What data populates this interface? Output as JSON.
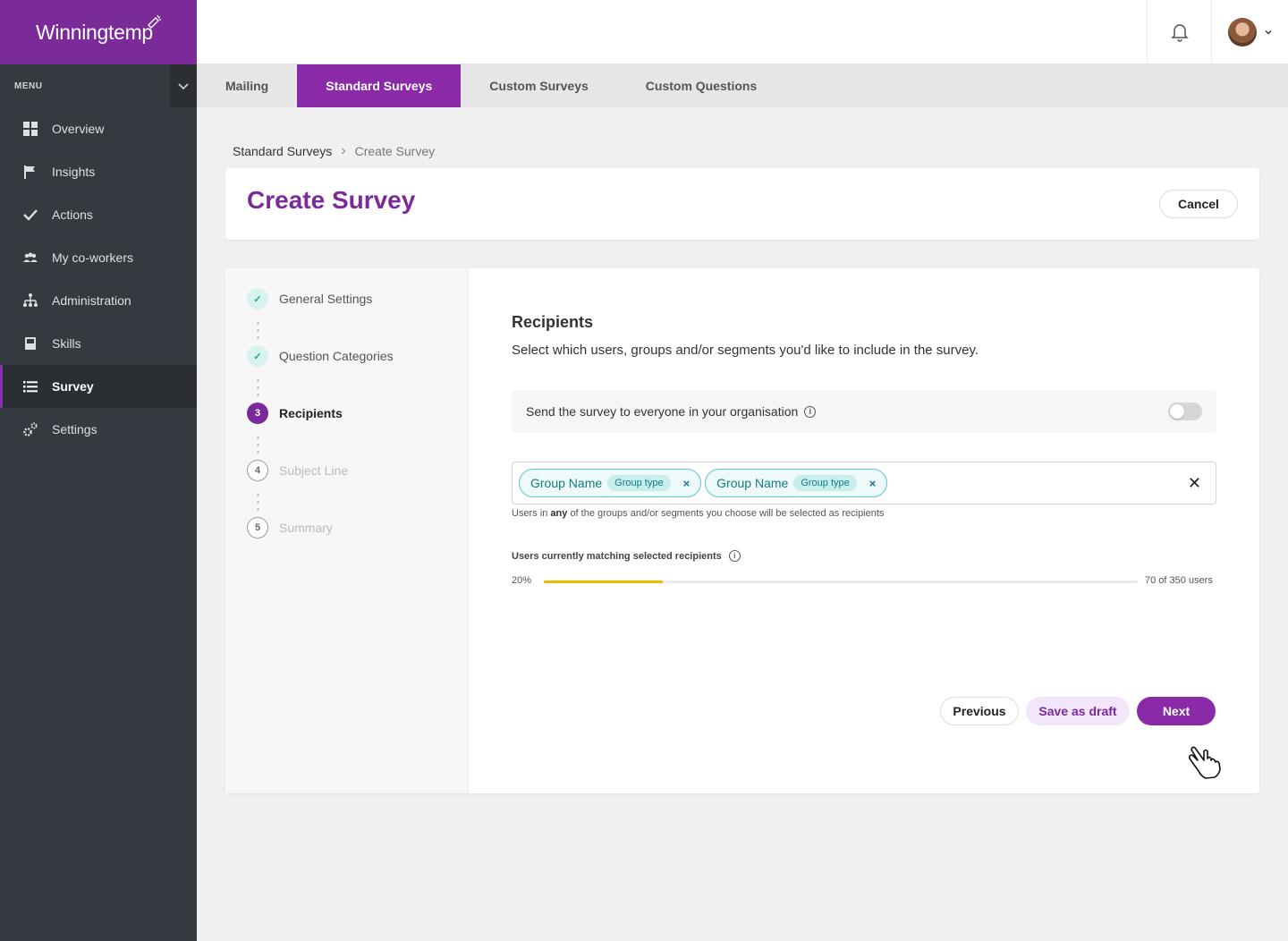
{
  "brand": {
    "name": "Winningtemp"
  },
  "menu": {
    "label": "MENU",
    "items": [
      {
        "label": "Overview",
        "icon": "grid-icon"
      },
      {
        "label": "Insights",
        "icon": "flag-icon"
      },
      {
        "label": "Actions",
        "icon": "check-icon"
      },
      {
        "label": "My co-workers",
        "icon": "people-icon"
      },
      {
        "label": "Administration",
        "icon": "org-chart-icon"
      },
      {
        "label": "Skills",
        "icon": "book-icon"
      },
      {
        "label": "Survey",
        "icon": "list-icon",
        "active": true
      },
      {
        "label": "Settings",
        "icon": "gears-icon"
      }
    ]
  },
  "tabs": [
    {
      "label": "Mailing"
    },
    {
      "label": "Standard Surveys",
      "active": true
    },
    {
      "label": "Custom Surveys"
    },
    {
      "label": "Custom Questions"
    }
  ],
  "breadcrumb": {
    "parent": "Standard Surveys",
    "separator": "›",
    "current": "Create Survey"
  },
  "page": {
    "title": "Create Survey",
    "cancel_label": "Cancel"
  },
  "steps": [
    {
      "label": "General Settings",
      "state": "done",
      "marker": "✓"
    },
    {
      "label": "Question Categories",
      "state": "done",
      "marker": "✓"
    },
    {
      "label": "Recipients",
      "state": "current",
      "marker": "3"
    },
    {
      "label": "Subject Line",
      "state": "todo",
      "marker": "4"
    },
    {
      "label": "Summary",
      "state": "todo",
      "marker": "5"
    }
  ],
  "recipients": {
    "title": "Recipients",
    "description": "Select which users, groups and/or segments you'd like to include in the survey.",
    "send_everyone_label": "Send the survey to everyone in your organisation",
    "send_everyone_enabled": false,
    "chips": [
      {
        "name": "Group Name",
        "type": "Group type"
      },
      {
        "name": "Group Name",
        "type": "Group type"
      }
    ],
    "hint_prefix": "Users in",
    "hint_emphasis": "any",
    "hint_suffix": "of the groups and/or segments you choose will be selected as recipients",
    "matching_label": "Users currently matching selected recipients",
    "percent_label": "20%",
    "percent_value": 0.2,
    "count_label": "70 of 350 users"
  },
  "actions": {
    "previous": "Previous",
    "save_draft": "Save as draft",
    "next": "Next"
  },
  "colors": {
    "brand": "#7b2a9a",
    "accent": "#8a2aa8",
    "sidebar": "#353a40",
    "progress": "#f2b800",
    "chip": "#127b80"
  }
}
